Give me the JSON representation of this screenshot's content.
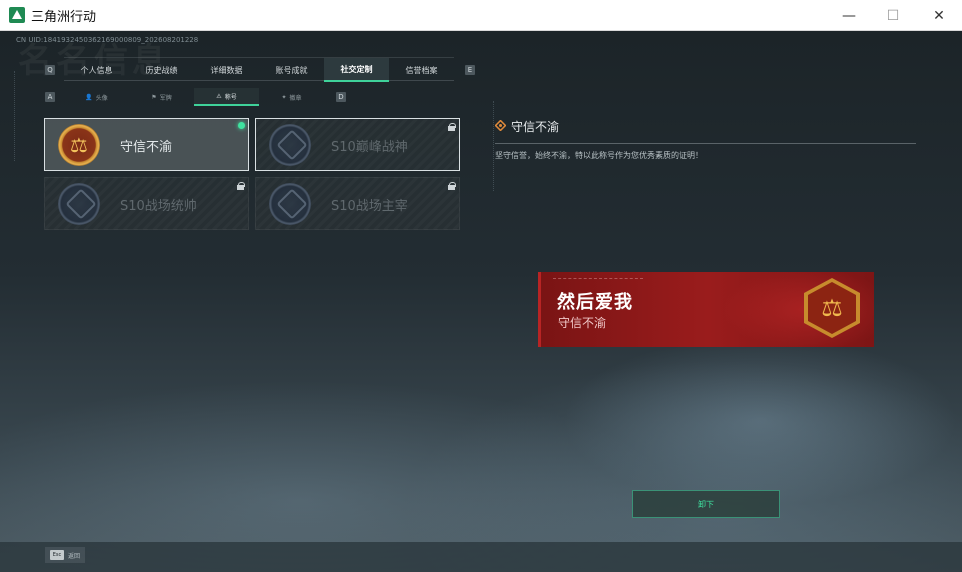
{
  "window": {
    "title": "三角洲行动",
    "minimize_label": "—",
    "maximize_label": "☐",
    "close_label": "✕"
  },
  "uid_text": "CN UID:1841932450362169000809_202608201228",
  "bg_watermark": "名名信息",
  "main_tabs": [
    {
      "label": "个人信息",
      "active": false
    },
    {
      "label": "历史战绩",
      "active": false
    },
    {
      "label": "详细数据",
      "active": false
    },
    {
      "label": "账号成就",
      "active": false
    },
    {
      "label": "社交定制",
      "active": true
    },
    {
      "label": "信誉档案",
      "active": false
    }
  ],
  "main_nav": {
    "left_key": "Q",
    "right_key": "E"
  },
  "sub_tabs": [
    {
      "label": "头像",
      "icon": "avatar-icon",
      "active": false
    },
    {
      "label": "军牌",
      "icon": "tag-icon",
      "active": false
    },
    {
      "label": "称号",
      "icon": "title-icon",
      "active": true
    },
    {
      "label": "徽章",
      "icon": "badge-icon",
      "active": false
    }
  ],
  "sub_nav": {
    "left_key": "A",
    "right_key": "D"
  },
  "titles": [
    {
      "label": "守信不渝",
      "locked": false,
      "equipped": true,
      "selected": true
    },
    {
      "label": "S10巅峰战神",
      "locked": true,
      "equipped": false,
      "selected": false
    },
    {
      "label": "S10战场统帅",
      "locked": true,
      "equipped": false,
      "selected": false
    },
    {
      "label": "S10战场主宰",
      "locked": true,
      "equipped": false,
      "selected": false
    }
  ],
  "detail": {
    "title": "守信不渝",
    "description": "坚守信誉，始终不渝，特以此称号作为您优秀素质的证明！"
  },
  "preview": {
    "player_name": "然后爱我",
    "title": "守信不渝"
  },
  "actions": {
    "unequip_label": "卸下"
  },
  "bottom": {
    "esc_key": "Esc",
    "esc_label": "返回"
  },
  "colors": {
    "accent": "#3fd29a",
    "banner_red": "#9a1c1c",
    "gold": "#e9b351"
  }
}
